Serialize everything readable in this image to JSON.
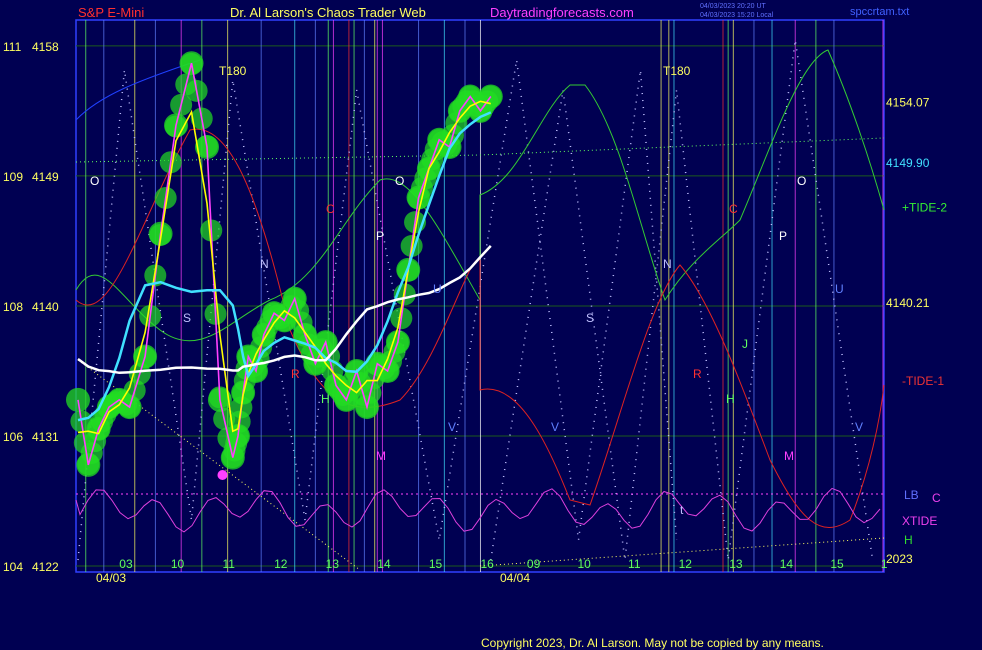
{
  "header": {
    "symbol": "S&P E-Mini",
    "title": "Dr. Al Larson's Chaos Trader Web",
    "site": "Daytradingforecasts.com",
    "ts1": "04/03/2023 20:20 UT",
    "ts2": "04/03/2023 15:20 Local",
    "file": "spccrtam.txt"
  },
  "footer": {
    "copyright": "Copyright 2023, Dr. Al Larson. May not be copied by any means."
  },
  "colors": {
    "background": "#000052",
    "price": "#ff40ff",
    "avg_fast": "#ffff00",
    "avg_mid": "#40e0ff",
    "avg_slow": "#ffffff",
    "glow": "#22dd22",
    "tide_pos": "#33cc33",
    "tide_neg": "#dd2222",
    "xtide": "#dd40dd"
  },
  "chart_data": {
    "type": "line",
    "y_left_ticks": [
      {
        "a": "111",
        "b": "4158",
        "v": 4158
      },
      {
        "a": "109",
        "b": "4149",
        "v": 4149
      },
      {
        "a": "108",
        "b": "4140",
        "v": 4140
      },
      {
        "a": "106",
        "b": "4131",
        "v": 4131
      },
      {
        "a": "104",
        "b": "4122",
        "v": 4122
      }
    ],
    "ylim": [
      4122,
      4160
    ],
    "right_labels": [
      {
        "text": "4154.07",
        "v": 4154.07,
        "color": "#ffff60"
      },
      {
        "text": "4149.90",
        "v": 4149.9,
        "color": "#40e0ff"
      },
      {
        "text": "+TIDE-2",
        "v": 4146.8,
        "color": "#33ee33"
      },
      {
        "text": "4140.21",
        "v": 4140.21,
        "color": "#ffff60"
      },
      {
        "text": "-TIDE-1",
        "v": 4134.8,
        "color": "#ee3333"
      },
      {
        "text": "LB",
        "v": 4126.9,
        "color": "#6070ff"
      },
      {
        "text": "C",
        "v": 4126.7,
        "color": "#ee40ee"
      },
      {
        "text": "XTIDE",
        "v": 4125.1,
        "color": "#ee40ee"
      },
      {
        "text": "H",
        "v": 4123.8,
        "color": "#30dd30"
      },
      {
        "text": "2023",
        "v": 4122.5,
        "color": "#ffff60"
      }
    ],
    "x_hours_day1": [
      "03",
      "10",
      "11",
      "12",
      "13",
      "14",
      "15",
      "16"
    ],
    "x_hours_day2": [
      "09",
      "10",
      "11",
      "12",
      "13",
      "14",
      "15",
      "1"
    ],
    "x_dates": [
      "04/03",
      "04/04"
    ],
    "markers": [
      "O",
      "S",
      "N",
      "R",
      "T180",
      "C",
      "P",
      "M",
      "H",
      "U",
      "V",
      "t",
      "J"
    ],
    "series": [
      {
        "name": "",
        "x": [
          0.0,
          0.2,
          0.4,
          0.6,
          0.8,
          1.0,
          1.3,
          1.6,
          1.9,
          2.2,
          2.5,
          2.75,
          3.0,
          3.1,
          3.2,
          3.3,
          3.45,
          3.6,
          3.8,
          4.0,
          4.2,
          4.4,
          4.6,
          4.8,
          5.0,
          5.2,
          5.4,
          5.6,
          5.8,
          6.0,
          6.2,
          6.4,
          6.6,
          6.8,
          7.0,
          7.2,
          7.4,
          7.6,
          7.8,
          8.0
        ],
        "y": [
          4133.5,
          4129.0,
          4131.5,
          4133.0,
          4133.5,
          4133.0,
          4136.5,
          4145.0,
          4152.5,
          4156.8,
          4151.0,
          4133.5,
          4129.5,
          4131.0,
          4134.0,
          4136.5,
          4135.5,
          4138.0,
          4139.5,
          4139.0,
          4140.5,
          4138.0,
          4136.0,
          4137.5,
          4134.5,
          4133.5,
          4135.5,
          4133.0,
          4136.0,
          4135.5,
          4137.5,
          4142.5,
          4147.5,
          4149.5,
          4151.5,
          4151.0,
          4153.5,
          4154.5,
          4153.5,
          4154.5
        ]
      }
    ]
  }
}
